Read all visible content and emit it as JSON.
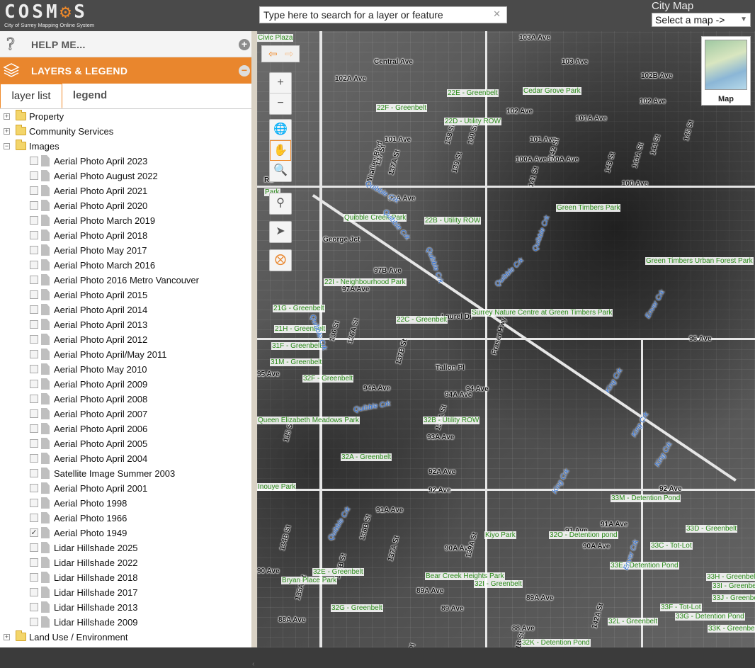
{
  "app": {
    "logo_text": "COSMOS",
    "logo_tagline": "City of Surrey Mapping Online System"
  },
  "search": {
    "placeholder": "Type here to search for a layer or feature"
  },
  "city_map": {
    "title": "City Map",
    "selected": "Select a map ->"
  },
  "panel": {
    "help_label": "HELP ME...",
    "layers_label": "LAYERS & LEGEND",
    "tabs": [
      {
        "label": "layer list"
      },
      {
        "label": "legend"
      }
    ],
    "groups_top": [
      {
        "label": "Property",
        "expanded": false
      },
      {
        "label": "Community Services",
        "expanded": false
      },
      {
        "label": "Images",
        "expanded": true
      }
    ],
    "image_layers": [
      {
        "label": "Aerial Photo April 2023",
        "checked": false
      },
      {
        "label": "Aerial Photo August 2022",
        "checked": false
      },
      {
        "label": "Aerial Photo April 2021",
        "checked": false
      },
      {
        "label": "Aerial Photo April 2020",
        "checked": false
      },
      {
        "label": "Aerial Photo March 2019",
        "checked": false
      },
      {
        "label": "Aerial Photo April 2018",
        "checked": false
      },
      {
        "label": "Aerial Photo May 2017",
        "checked": false
      },
      {
        "label": "Aerial Photo March 2016",
        "checked": false
      },
      {
        "label": "Aerial Photo 2016 Metro Vancouver",
        "checked": false
      },
      {
        "label": "Aerial Photo April 2015",
        "checked": false
      },
      {
        "label": "Aerial Photo April 2014",
        "checked": false
      },
      {
        "label": "Aerial Photo April 2013",
        "checked": false
      },
      {
        "label": "Aerial Photo April 2012",
        "checked": false
      },
      {
        "label": "Aerial Photo April/May 2011",
        "checked": false
      },
      {
        "label": "Aerial Photo May 2010",
        "checked": false
      },
      {
        "label": "Aerial Photo April 2009",
        "checked": false
      },
      {
        "label": "Aerial Photo April 2008",
        "checked": false
      },
      {
        "label": "Aerial Photo April 2007",
        "checked": false
      },
      {
        "label": "Aerial Photo April 2006",
        "checked": false
      },
      {
        "label": "Aerial Photo April 2005",
        "checked": false
      },
      {
        "label": "Aerial Photo April 2004",
        "checked": false
      },
      {
        "label": "Satellite Image Summer 2003",
        "checked": false
      },
      {
        "label": "Aerial Photo April 2001",
        "checked": false
      },
      {
        "label": "Aerial Photo 1998",
        "checked": false
      },
      {
        "label": "Aerial Photo 1966",
        "checked": false
      },
      {
        "label": "Aerial Photo 1949",
        "checked": true
      },
      {
        "label": "Lidar Hillshade 2025",
        "checked": false
      },
      {
        "label": "Lidar Hillshade 2022",
        "checked": false
      },
      {
        "label": "Lidar Hillshade 2018",
        "checked": false
      },
      {
        "label": "Lidar Hillshade 2017",
        "checked": false
      },
      {
        "label": "Lidar Hillshade 2013",
        "checked": false
      },
      {
        "label": "Lidar Hillshade 2009",
        "checked": false
      }
    ],
    "groups_bottom": [
      {
        "label": "Land Use / Environment",
        "expanded": false
      }
    ]
  },
  "map": {
    "overview_label": "Map",
    "streets_h": [
      "103A Ave",
      "Central Ave",
      "103 Ave",
      "102A Ave",
      "102B Ave",
      "102 Ave",
      "102 Ave",
      "101A Ave",
      "101 Ave",
      "101 Ave",
      "100A Ave",
      "100A Ave",
      "100 Ave",
      "99A Ave",
      "97B Ave",
      "97A Ave",
      "96 Ave",
      "95 Ave",
      "94A Ave",
      "94 Ave",
      "94A Ave",
      "93A Ave",
      "92A Ave",
      "92 Ave",
      "92 Ave",
      "91A Ave",
      "91 Ave",
      "91A Ave",
      "90A Ave",
      "90A Ave",
      "90 Ave",
      "89A Ave",
      "89 Ave",
      "89A Ave",
      "88A Ave",
      "88 Ave",
      "George Jct",
      "Laurel Dr",
      "Tallon Pl",
      "Rd"
    ],
    "streets_v": [
      "Whalley Blvd",
      "137 St",
      "137A St",
      "138 St",
      "139 St",
      "140 St",
      "141 St",
      "142 St",
      "143 St",
      "144 St",
      "145 St",
      "144A St",
      "135 St",
      "136 St",
      "136A St",
      "137B St",
      "138A St",
      "134B St",
      "135A St",
      "136B St",
      "137A St",
      "139A St",
      "138B St",
      "Roslin Pl",
      "141B St",
      "142A St",
      "Fraser Hwy"
    ],
    "parks": [
      "Civic Plaza",
      "22E - Greenbelt",
      "Cedar Grove Park",
      "22F - Greenbelt",
      "22D - Utility ROW",
      "Quibble Creek Park",
      "22B - Utility ROW",
      "Green Timbers Park",
      "Green Timbers Urban Forest Park",
      "22I - Neighbourhood Park",
      "Surrey Nature Centre at Green Timbers Park",
      "21G - Greenbelt",
      "22C - Greenbelt",
      "21H - Greenbelt",
      "31F - Greenbelt",
      "31M - Greenbelt",
      "32F - Greenbelt",
      "Queen Elizabeth Meadows Park",
      "32B - Utility ROW",
      "32A - Greenbelt",
      "Inouye Park",
      "33M - Detention Pond",
      "Kiyo Park",
      "32O - Detention pond",
      "33D - Greenbelt",
      "33C - Tot-Lot",
      "33E - Detention Pond",
      "Bear Creek Heights Park",
      "32E - Greenbelt",
      "Bryan Place Park",
      "32I - Greenbelt",
      "33H - Greenbelt",
      "33I - Greenbelt",
      "33J - Greenbelt",
      "32G - Greenbelt",
      "33F - Tot-Lot",
      "33G - Detention Pond",
      "32L - Greenbelt",
      "33K - Greenbelt",
      "32K - Detention Pond",
      "Park"
    ],
    "creeks": [
      "Quibble Crk",
      "Quibble Crk",
      "Quibble Crk",
      "Quibble Crk",
      "Quibble Crk",
      "Quibble Crk",
      "Quibble Crk",
      "King Crk",
      "King Crk",
      "King Crk",
      "King Crk",
      "Enver Crk",
      "Enver Crk",
      "Quibble Crk"
    ]
  }
}
